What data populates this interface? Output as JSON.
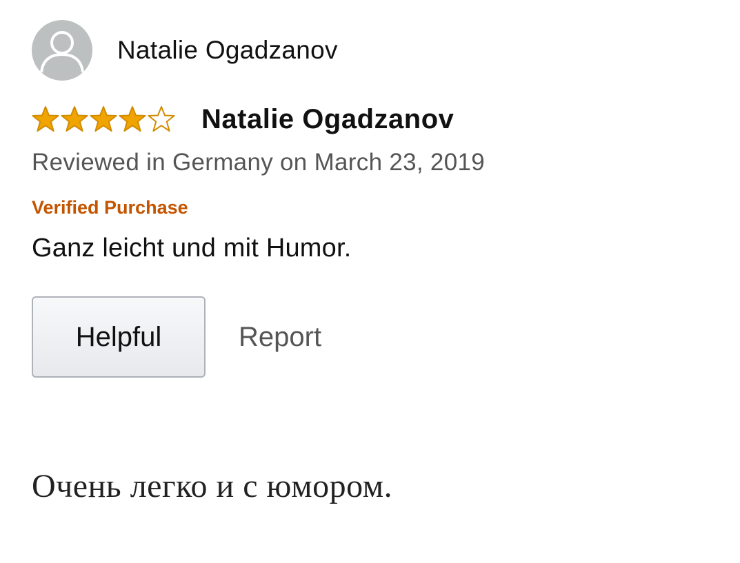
{
  "review": {
    "profile": {
      "name": "Natalie Ogadzanov",
      "avatar_icon": "user-avatar-icon"
    },
    "rating": {
      "value": 4,
      "max": 5,
      "star_color": "#f0a400",
      "star_outline": "#d18b00"
    },
    "title": "Natalie Ogadzanov",
    "meta": "Reviewed in Germany on March 23, 2019",
    "verified_label": "Verified Purchase",
    "verified_color": "#c45500",
    "body": "Ganz leicht und mit Humor.",
    "actions": {
      "helpful_label": "Helpful",
      "report_label": "Report"
    }
  },
  "translation": "Очень легко и с юмором."
}
